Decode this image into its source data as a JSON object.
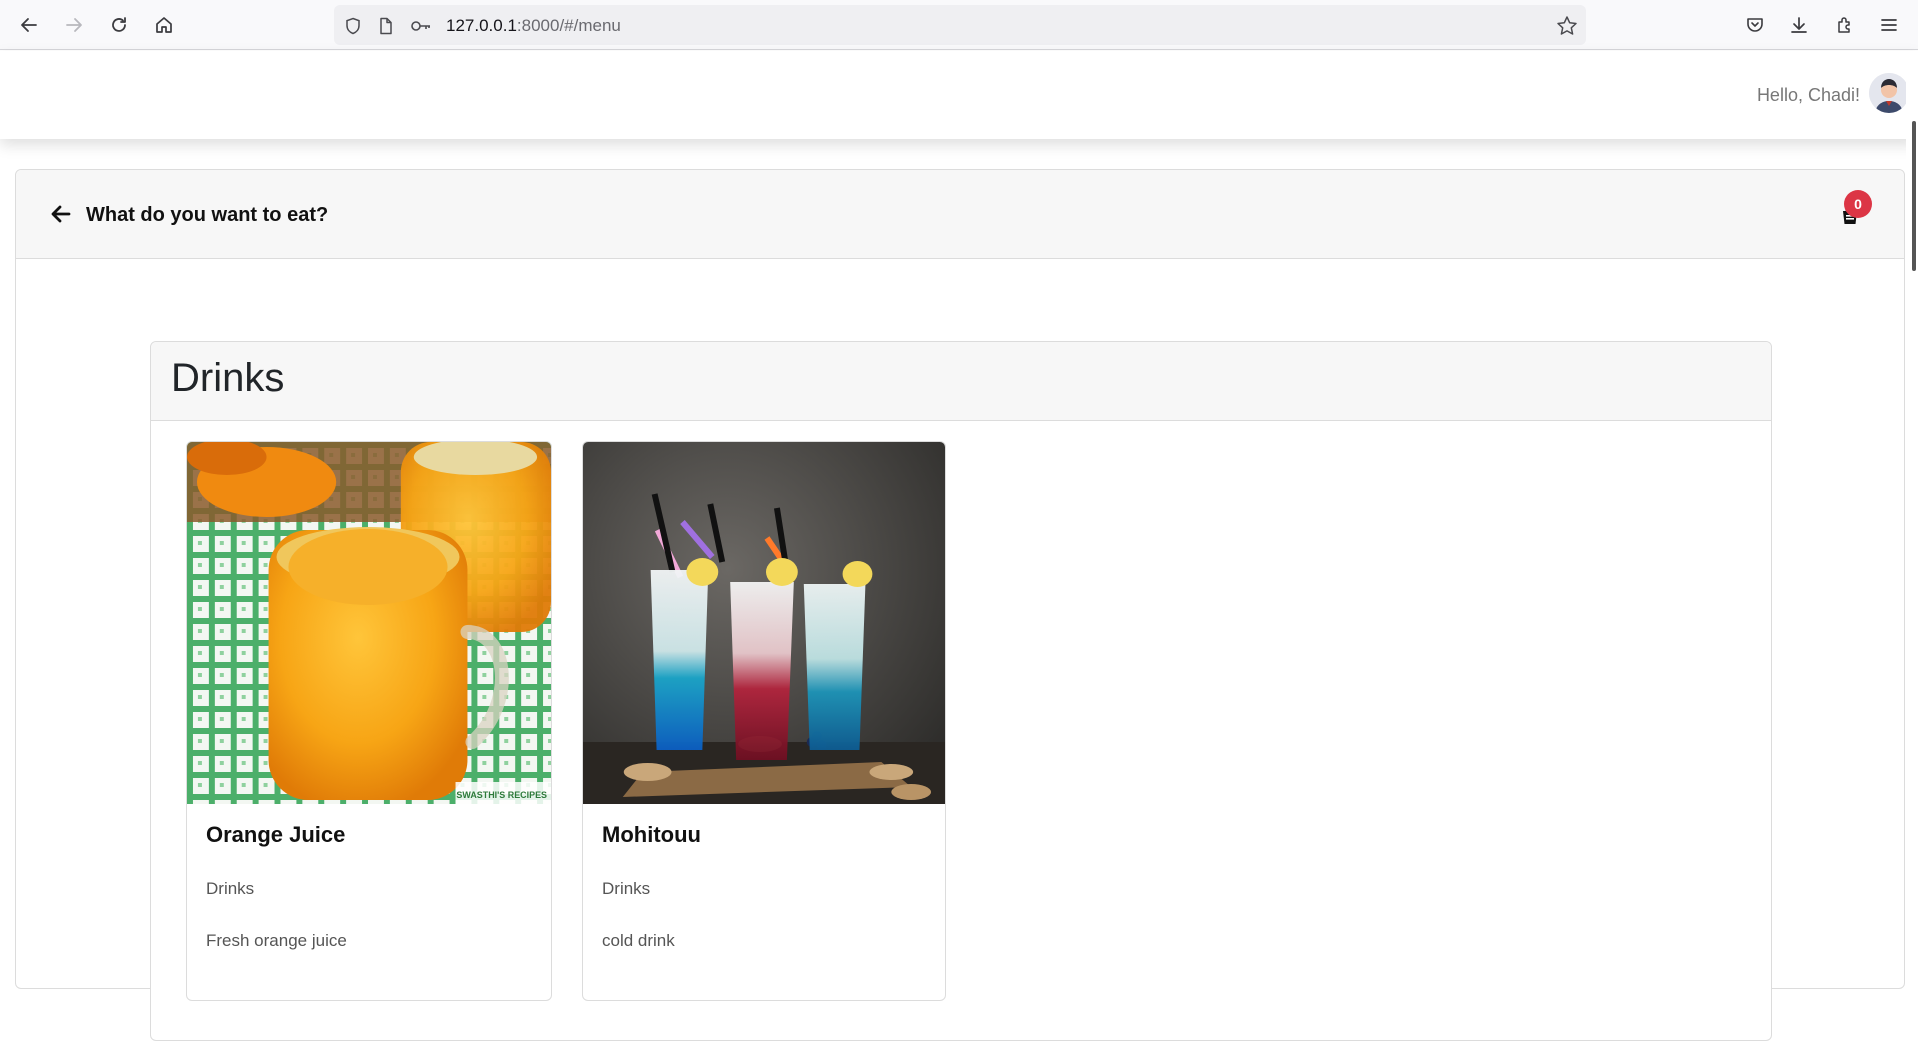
{
  "browser": {
    "url_host": "127.0.0.1",
    "url_rest": ":8000/#/menu"
  },
  "header": {
    "greeting": "Hello, Chadi!"
  },
  "page": {
    "title": "What do you want to eat?",
    "cart_count": "0"
  },
  "section": {
    "title": "Drinks",
    "products": [
      {
        "name": "Orange Juice",
        "category": "Drinks",
        "description": "Fresh orange juice",
        "watermark": "SWASTHI'S RECIPES"
      },
      {
        "name": "Mohitouu",
        "category": "Drinks",
        "description": "cold drink"
      }
    ]
  },
  "colors": {
    "badge": "#dc3545",
    "card_header_bg": "#f7f7f7"
  }
}
